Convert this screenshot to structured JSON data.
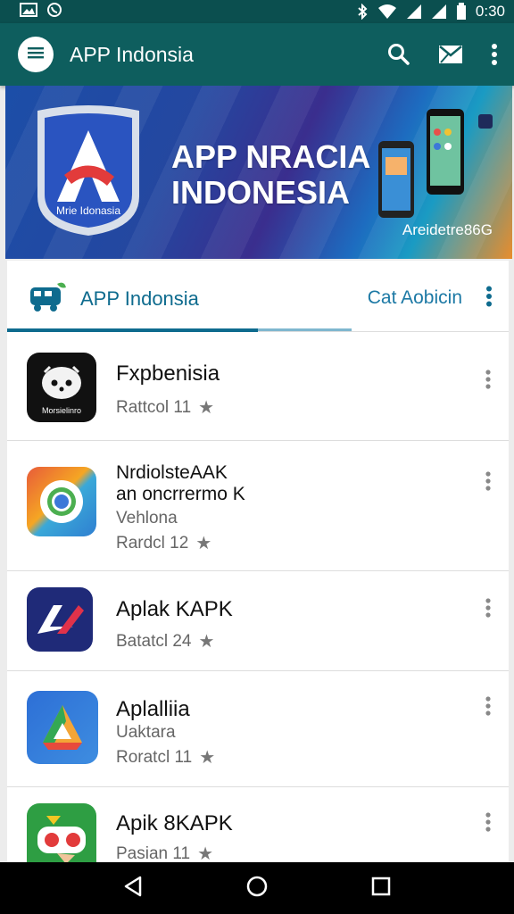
{
  "status_bar": {
    "time": "0:30"
  },
  "app_bar": {
    "title": "APP Indonsia"
  },
  "banner": {
    "logo_text": "Mrie Idonasia",
    "headline_line1": "APP NRACIA",
    "headline_line2": "INDONESIA",
    "caption": "Areidetre86G"
  },
  "tabs": {
    "primary_label": "APP Indonsia",
    "secondary_label": "Cat Aobicin"
  },
  "apps": [
    {
      "name": "Fxpbenisia",
      "icon_text": "Morsielinro",
      "rating": "Rattcol 11"
    },
    {
      "name": "NrdiolsteAAK\nan oncrrermo K",
      "subtitle": "Vehlona",
      "rating": "Rardcl 12"
    },
    {
      "name": "Aplak KAPK",
      "rating": "Batatcl 24"
    },
    {
      "name": "Aplalliia",
      "subtitle": "Uaktara",
      "rating": "Roratcl 11"
    },
    {
      "name": "Apik 8KAPK",
      "rating": "Pasian 11"
    }
  ],
  "colors": {
    "primary": "#0e5e5e",
    "accent": "#0e6b8e"
  }
}
